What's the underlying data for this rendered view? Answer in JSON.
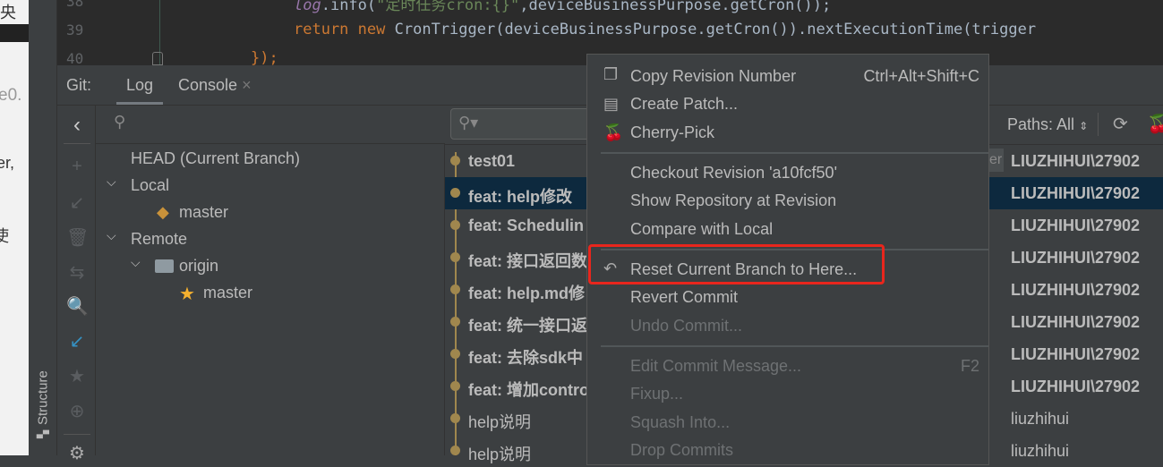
{
  "background_doc": {
    "fragments": [
      "央",
      "e0.",
      "er,",
      "使"
    ]
  },
  "tool_stripe": {
    "structure_label": "Structure"
  },
  "editor": {
    "lines": [
      {
        "number": "38",
        "code_a": "log",
        "code_b": ".info(",
        "code_c": "\"定时任务cron:{}\"",
        "code_d": ",deviceBusinessPurpose.getCron());"
      },
      {
        "number": "39",
        "kw1": "return",
        "kw2": "new",
        "code": "CronTrigger(deviceBusinessPurpose.getCron()).nextExecutionTime(trigger"
      },
      {
        "number": "40",
        "code": "});"
      }
    ]
  },
  "git_panel": {
    "label": "Git:",
    "tabs": [
      {
        "label": "Log",
        "active": true
      },
      {
        "label": "Console",
        "closable": true
      }
    ]
  },
  "branches": {
    "head": "HEAD (Current Branch)",
    "local": "Local",
    "local_branches": [
      "master"
    ],
    "remote": "Remote",
    "origin": "origin",
    "remote_branches": [
      "master"
    ]
  },
  "toolbar": {
    "paths_label": "Paths: All"
  },
  "commits": [
    {
      "message": "test01",
      "author": "LIUZHIHUI\\27902",
      "bold": true,
      "tag": "er"
    },
    {
      "message": "feat: help修改",
      "author": "LIUZHIHUI\\27902",
      "bold": true,
      "selected": true
    },
    {
      "message": "feat: Schedulin",
      "author": "LIUZHIHUI\\27902",
      "bold": true
    },
    {
      "message": "feat: 接口返回数",
      "author": "LIUZHIHUI\\27902",
      "bold": true
    },
    {
      "message": "feat: help.md修",
      "author": "LIUZHIHUI\\27902",
      "bold": true
    },
    {
      "message": "feat: 统一接口返",
      "author": "LIUZHIHUI\\27902",
      "bold": true
    },
    {
      "message": "feat: 去除sdk中",
      "author": "LIUZHIHUI\\27902",
      "bold": true
    },
    {
      "message": "feat: 增加contro",
      "author": "LIUZHIHUI\\27902",
      "bold": true
    },
    {
      "message": "help说明",
      "author": "liuzhihui",
      "bold": false
    },
    {
      "message": "help说明",
      "author": "liuzhihui",
      "bold": false
    }
  ],
  "context_menu": {
    "items": [
      {
        "label": "Copy Revision Number",
        "shortcut": "Ctrl+Alt+Shift+C",
        "icon": "copy-icon"
      },
      {
        "label": "Create Patch...",
        "icon": "patch-icon"
      },
      {
        "label": "Cherry-Pick",
        "icon": "cherry-icon"
      },
      {
        "label": "Checkout Revision 'a10fcf50'"
      },
      {
        "label": "Show Repository at Revision"
      },
      {
        "label": "Compare with Local"
      },
      {
        "label": "Reset Current Branch to Here...",
        "icon": "undo-icon",
        "highlighted": true
      },
      {
        "label": "Revert Commit"
      },
      {
        "label": "Undo Commit...",
        "disabled": true
      },
      {
        "label": "Edit Commit Message...",
        "shortcut": "F2",
        "disabled": true
      },
      {
        "label": "Fixup...",
        "disabled": true
      },
      {
        "label": "Squash Into...",
        "disabled": true
      },
      {
        "label": "Drop Commits",
        "disabled": true
      }
    ]
  },
  "colors": {
    "highlight_box": "#e8261d",
    "selection": "#0d293e",
    "graph": "#a0874e",
    "tag": "#c9923a",
    "star": "#f5b12f"
  }
}
